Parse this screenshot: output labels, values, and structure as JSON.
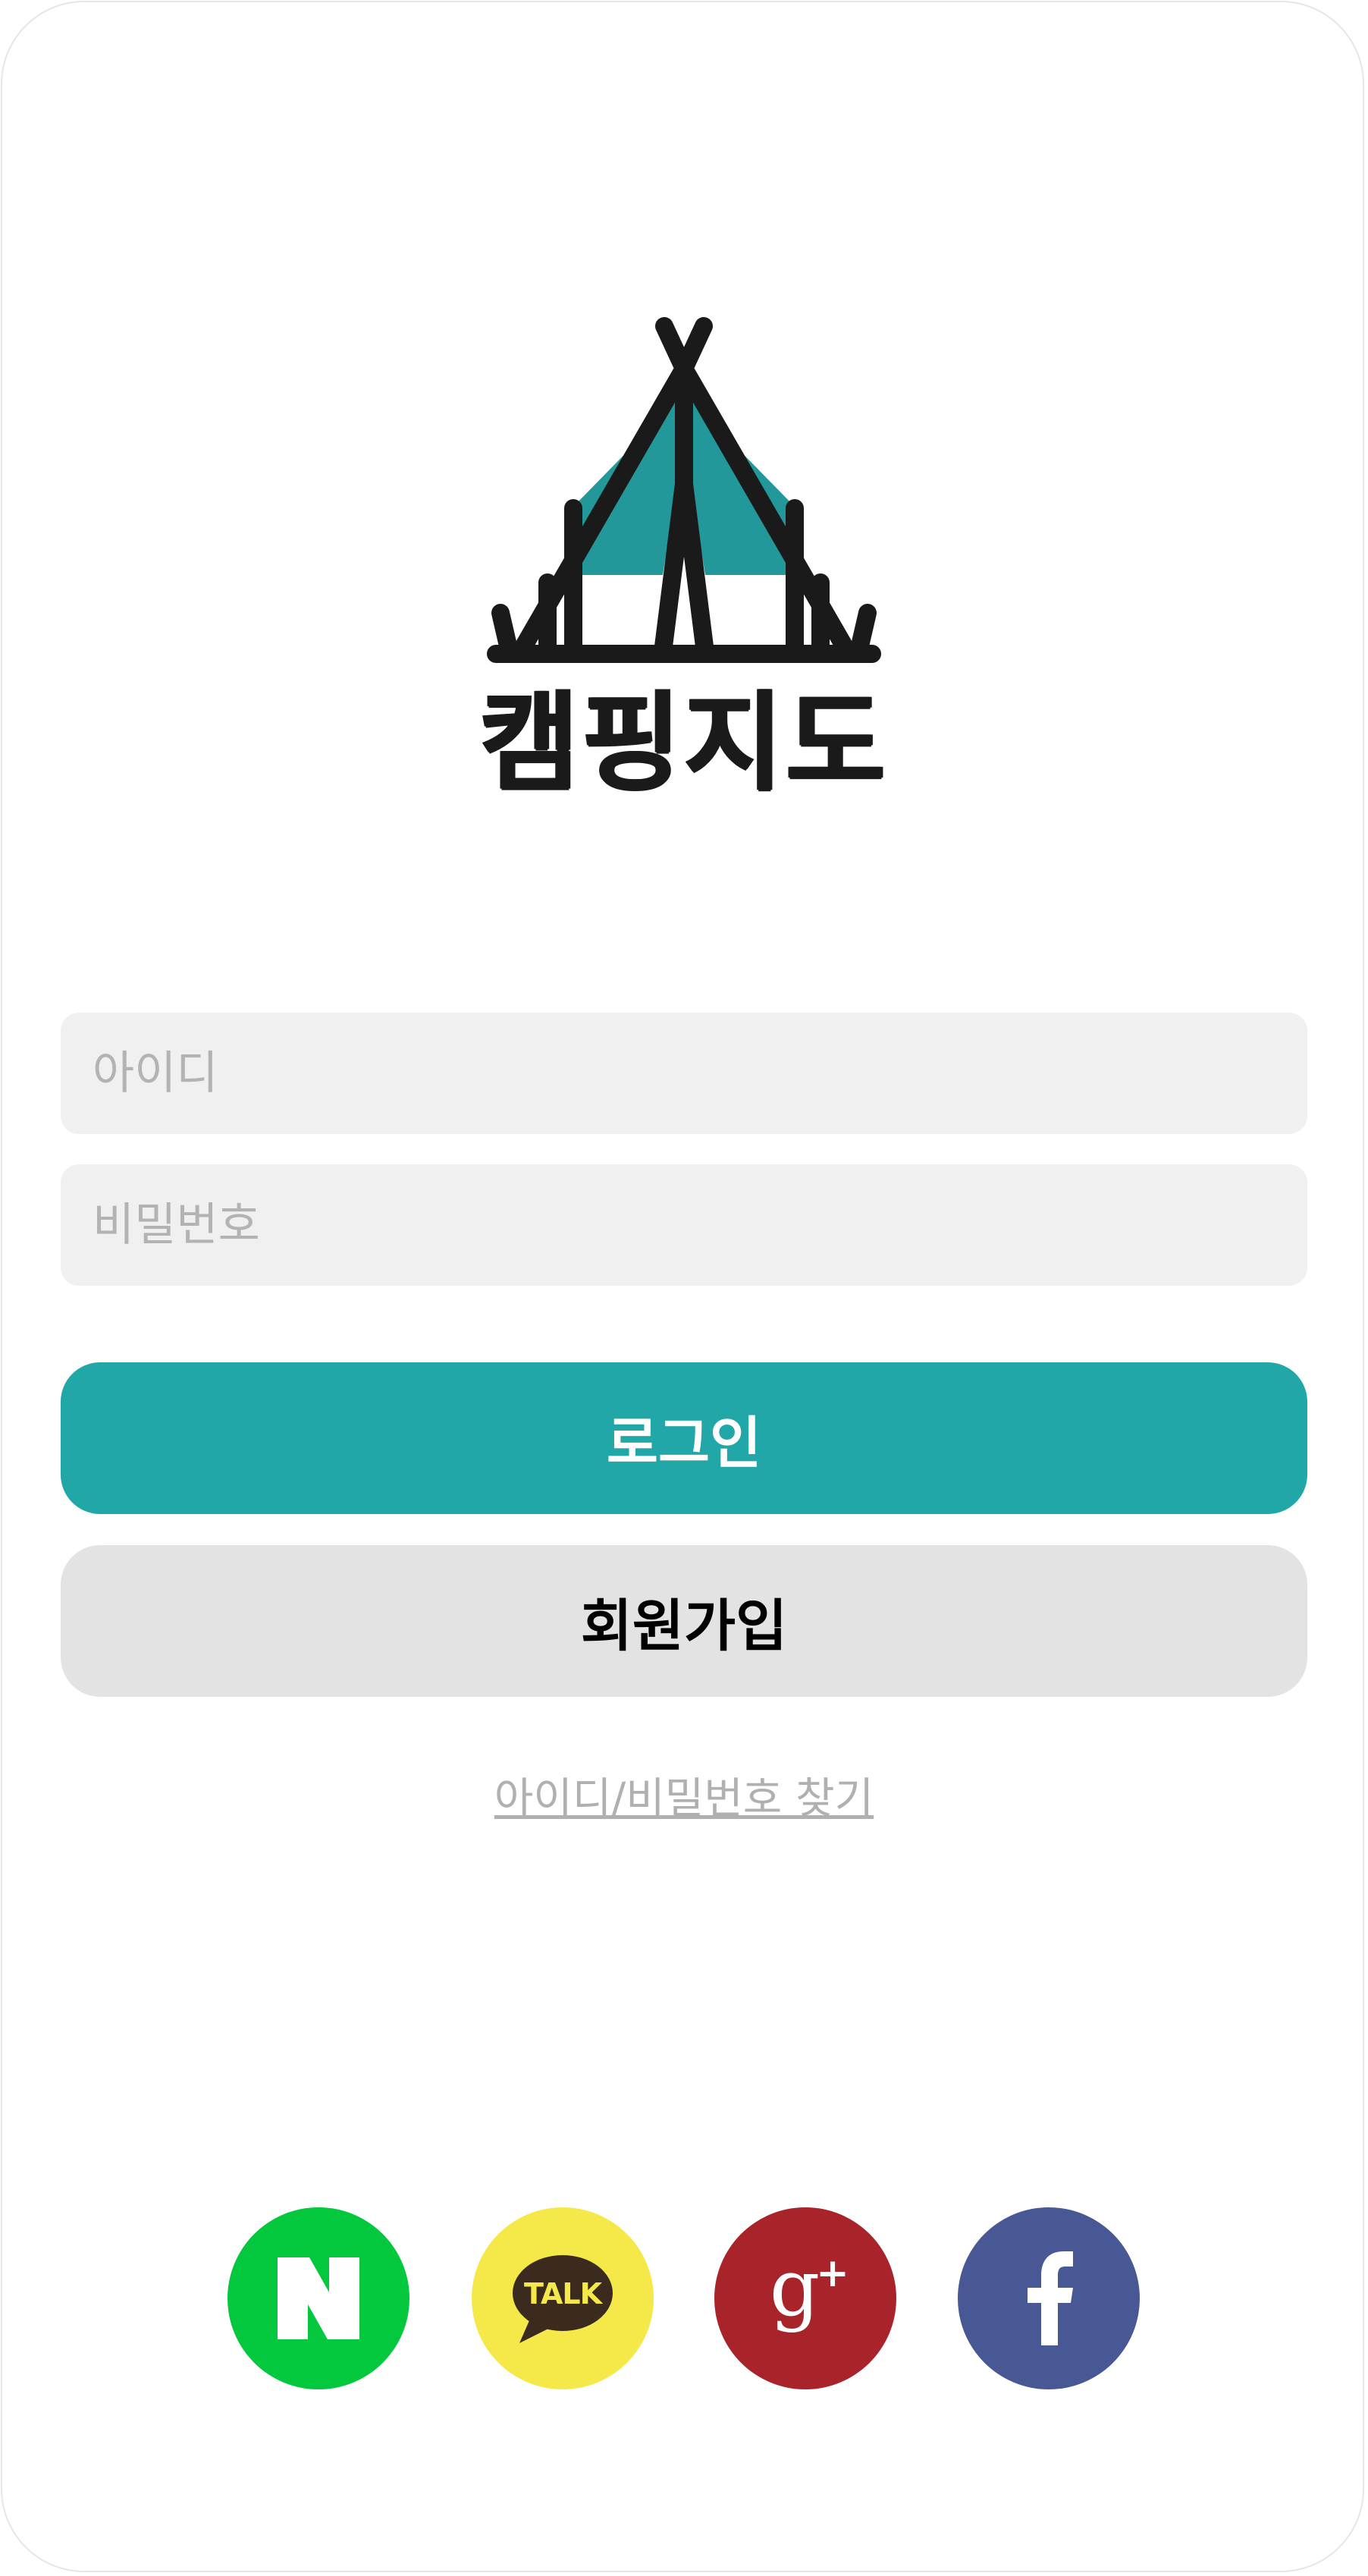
{
  "app": {
    "name": "캠핑지도"
  },
  "login_form": {
    "id_placeholder": "아이디",
    "password_placeholder": "비밀번호",
    "id_value": "",
    "password_value": ""
  },
  "buttons": {
    "login_label": "로그인",
    "signup_label": "회원가입",
    "find_account_label": "아이디/비밀번호 찾기"
  },
  "social_logins": [
    {
      "icon": "naver-icon",
      "color": "#03c83e",
      "glyph": "N"
    },
    {
      "icon": "kakaotalk-icon",
      "color": "#f5e94a",
      "glyph": "TALK"
    },
    {
      "icon": "google-plus-icon",
      "color": "#a9242a",
      "glyph": "g+"
    },
    {
      "icon": "facebook-icon",
      "color": "#475894",
      "glyph": "f"
    }
  ],
  "colors": {
    "brand": "#22a7a8",
    "logo_dark": "#1b1a1a",
    "input_bg": "#f0f0f0",
    "secondary_button": "#e3e3e3"
  }
}
